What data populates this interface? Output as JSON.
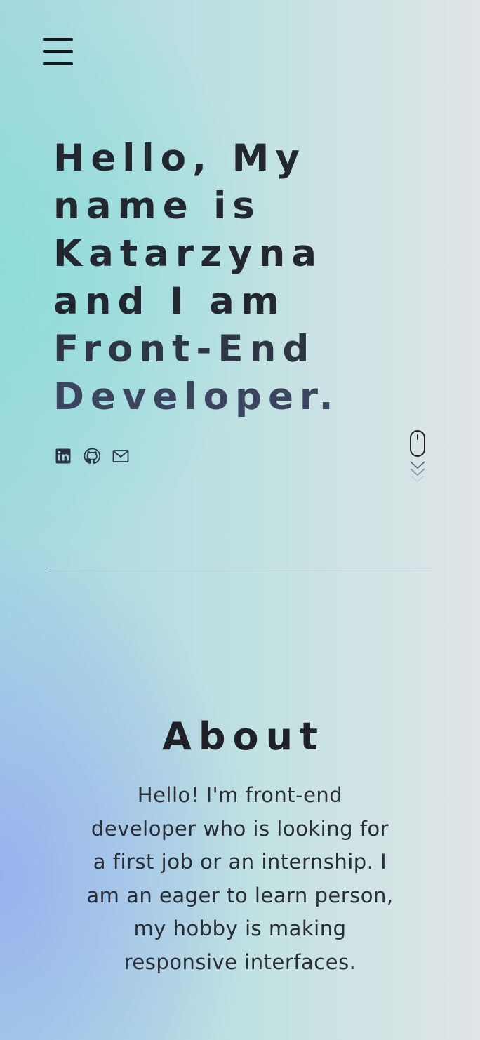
{
  "header": {
    "menu_icon": "hamburger-menu-icon"
  },
  "hero": {
    "title_lines": [
      "Hello, My",
      "name is",
      "Katarzyna",
      "and I am",
      "Front-End",
      "Developer."
    ],
    "socials": [
      {
        "icon": "linkedin-icon"
      },
      {
        "icon": "github-icon"
      },
      {
        "icon": "mail-icon"
      }
    ],
    "scroll_indicator_icon": "mouse-scroll-icon"
  },
  "about": {
    "heading": "About",
    "text_lines": [
      "Hello! I'm front-end",
      "developer who is looking for",
      "a first job or an internship. I",
      "am an eager to learn person,",
      "my hobby is making",
      "responsive interfaces."
    ]
  },
  "colors": {
    "text_dark": "#23272f",
    "title_fade": "#3c4560",
    "gradient_teal": "#8cdeda",
    "gradient_blue": "#98b0f0",
    "gradient_light": "#e0e4e6"
  }
}
